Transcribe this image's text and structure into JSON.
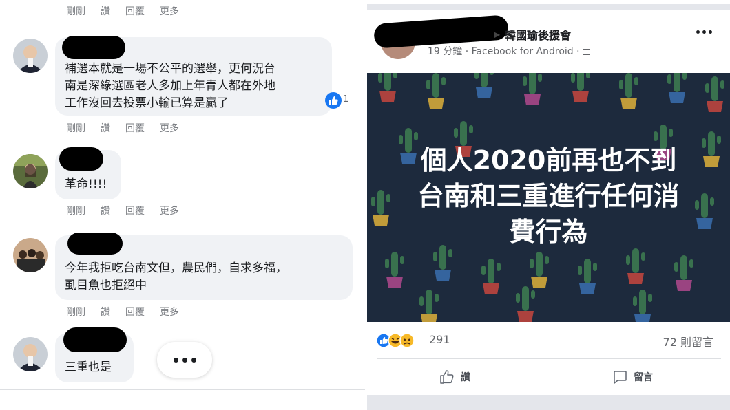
{
  "colors": {
    "bubble": "#f0f2f5",
    "meta_text": "#7a7d82",
    "facebook_blue": "#1877f2",
    "post_bg": "#1d2a3d"
  },
  "comments": {
    "actions": [
      "剛剛",
      "讚",
      "回覆",
      "更多"
    ],
    "items": [
      {
        "text_lines": [
          "補選本就是一場不公平的選舉，更何況台",
          "南是深綠選區老人多加上年青人都在外地",
          "工作沒回去投票小輸已算是贏了"
        ],
        "like_count": "1"
      },
      {
        "text_lines": [
          "革命!!!!"
        ]
      },
      {
        "text_lines": [
          "今年我拒吃台南文但，農民們，自求多福，",
          "虱目魚也拒絕中"
        ]
      },
      {
        "text_lines": [
          "三重也是"
        ]
      }
    ],
    "more_icon": "ellipsis-icon"
  },
  "post": {
    "group_name": "韓國瑜後援會",
    "meta": "19 分鐘 · Facebook for Android · ",
    "menu_icon": "more-horizontal-icon",
    "image_text_lines": [
      "個人2020前再也不到",
      "台南和三重進行任何消",
      "費行為"
    ],
    "reaction_count": "291",
    "comment_count": "72 則留言",
    "like_label": "讚",
    "comment_label": "留言"
  }
}
